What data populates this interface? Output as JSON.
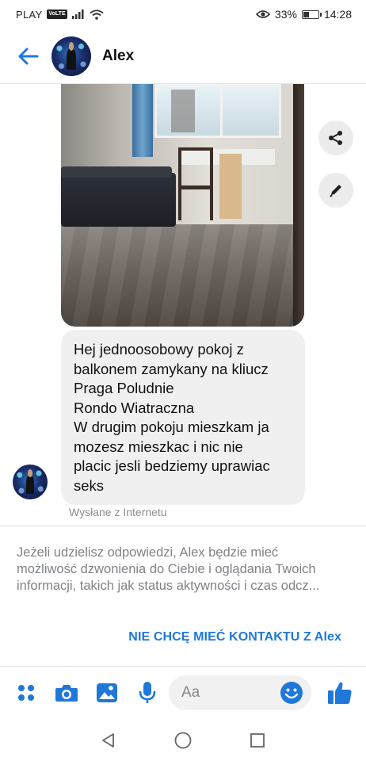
{
  "status_bar": {
    "carrier": "PLAY",
    "network_badge": "VoLTE",
    "battery": "33%",
    "battery_level": 0.33,
    "time": "14:28"
  },
  "header": {
    "contact_name": "Alex"
  },
  "message": {
    "text": "Hej jednoosobowy pokoj z\nbalkonem zamykany na kliucz\nPraga Poludnie\nRondo Wiatraczna\nW drugim pokoju mieszkam ja\nmozesz mieszkac i nic nie\nplacic jesli bedziemy uprawiac\nseks",
    "sent_via": "Wysłane z Internetu"
  },
  "notice": {
    "lines": [
      "Jeżeli udzielisz odpowiedzi, Alex będzie mieć",
      "możliwość dzwonienia do Ciebie i oglądania Twoich",
      "informacji, takich jak status aktywności i czas odcz..."
    ],
    "button_label": "NIE CHCĘ MIEĆ KONTAKTU Z Alex"
  },
  "composer": {
    "placeholder": "Aa"
  },
  "colors": {
    "accent": "#1f78d8",
    "bubble": "#f1f0f0"
  },
  "icons": [
    "arrow-left-icon",
    "share-icon",
    "pencil-icon",
    "apps-icon",
    "camera-icon",
    "image-icon",
    "microphone-icon",
    "emoji-icon",
    "thumbs-up-icon",
    "nav-back-icon",
    "nav-home-icon",
    "nav-recents-icon"
  ]
}
